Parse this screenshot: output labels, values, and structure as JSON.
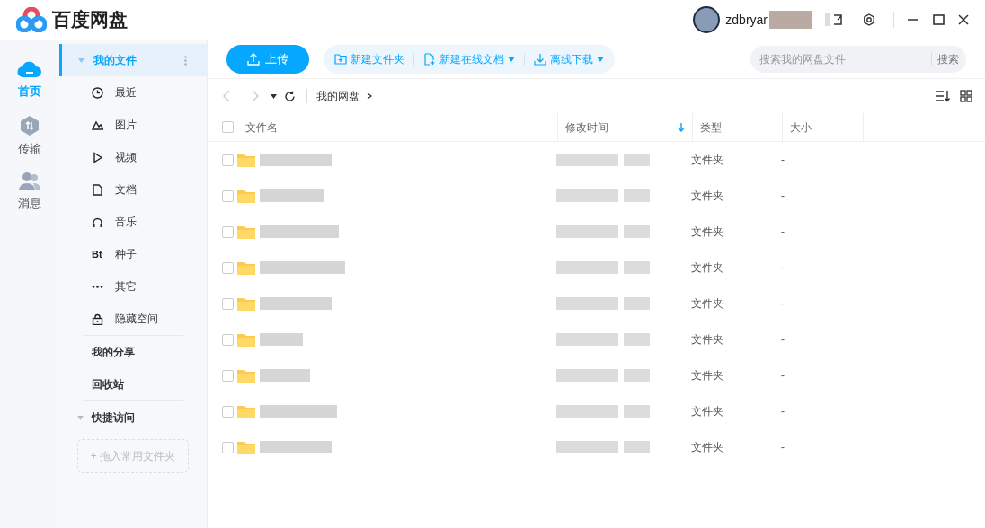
{
  "app": {
    "title": "百度网盘"
  },
  "user": {
    "name": "zdbryar",
    "name_redacted": true
  },
  "nav": [
    {
      "label": "首页",
      "kind": "cloud",
      "selected": true
    },
    {
      "label": "传输",
      "kind": "transfer",
      "selected": false
    },
    {
      "label": "消息",
      "kind": "people",
      "selected": false
    }
  ],
  "sidebar": {
    "section": {
      "label": "我的文件",
      "expanded": true,
      "selected": true
    },
    "items": [
      {
        "label": "最近",
        "kind": "clock"
      },
      {
        "label": "图片",
        "kind": "image"
      },
      {
        "label": "视频",
        "kind": "play"
      },
      {
        "label": "文档",
        "kind": "doc"
      },
      {
        "label": "音乐",
        "kind": "headphones"
      },
      {
        "label": "种子",
        "kind": "text",
        "icon_text": "Bt"
      },
      {
        "label": "其它",
        "kind": "dots"
      },
      {
        "label": "隐藏空间",
        "kind": "lock"
      }
    ],
    "links": [
      {
        "label": "我的分享"
      },
      {
        "label": "回收站"
      }
    ],
    "quick": {
      "label": "快捷访问",
      "expanded": true,
      "drop_hint": "+ 拖入常用文件夹"
    }
  },
  "toolbar": {
    "upload": "上传",
    "actions": [
      {
        "label": "新建文件夹",
        "kind": "folder-plus",
        "dropdown": false
      },
      {
        "label": "新建在线文档",
        "kind": "doc-plus",
        "dropdown": true
      },
      {
        "label": "离线下载",
        "kind": "download",
        "dropdown": true
      }
    ],
    "search": {
      "placeholder": "搜索我的网盘文件",
      "button": "搜索"
    }
  },
  "breadcrumb": [
    {
      "label": "我的网盘"
    }
  ],
  "table": {
    "all_checked": false,
    "columns": [
      {
        "label": "文件名",
        "sorted": false
      },
      {
        "label": "修改时间",
        "sorted": true
      },
      {
        "label": "类型",
        "sorted": false
      },
      {
        "label": "大小",
        "sorted": false
      }
    ],
    "rows": [
      {
        "name_redacted": true,
        "time_redacted": true,
        "type": "文件夹",
        "size": "-",
        "checked": false
      },
      {
        "name_redacted": true,
        "time_redacted": true,
        "type": "文件夹",
        "size": "-",
        "checked": false
      },
      {
        "name_redacted": true,
        "time_redacted": true,
        "type": "文件夹",
        "size": "-",
        "checked": false
      },
      {
        "name_redacted": true,
        "time_redacted": true,
        "type": "文件夹",
        "size": "-",
        "checked": false
      },
      {
        "name_redacted": true,
        "time_redacted": true,
        "type": "文件夹",
        "size": "-",
        "checked": false
      },
      {
        "name_redacted": true,
        "time_redacted": true,
        "type": "文件夹",
        "size": "-",
        "checked": false
      },
      {
        "name_redacted": true,
        "time_redacted": true,
        "type": "文件夹",
        "size": "-",
        "checked": false
      },
      {
        "name_redacted": true,
        "time_redacted": true,
        "type": "文件夹",
        "size": "-",
        "checked": false
      },
      {
        "name_redacted": true,
        "time_redacted": true,
        "type": "文件夹",
        "size": "-",
        "checked": false
      }
    ]
  }
}
